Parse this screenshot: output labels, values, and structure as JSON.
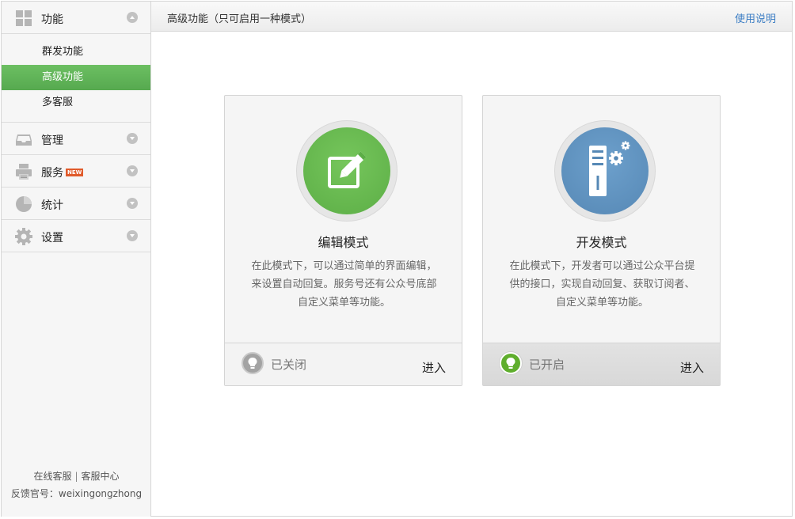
{
  "sidebar": {
    "groups": [
      {
        "label": "功能",
        "icon": "grid-icon",
        "arrow": "up"
      },
      {
        "label": "管理",
        "icon": "inbox-icon",
        "arrow": "down"
      },
      {
        "label": "服务",
        "icon": "printer-icon",
        "arrow": "down",
        "badge": "NEW"
      },
      {
        "label": "统计",
        "icon": "pie-chart-icon",
        "arrow": "down"
      },
      {
        "label": "设置",
        "icon": "gear-icon",
        "arrow": "down"
      }
    ],
    "function_items": [
      {
        "label": "群发功能"
      },
      {
        "label": "高级功能"
      },
      {
        "label": "多客服"
      }
    ],
    "footer": {
      "online_service": "在线客服",
      "separator": "|",
      "service_center": "客服中心",
      "feedback": "反馈官号：weixingongzhong"
    }
  },
  "header": {
    "title": "高级功能（只可启用一种模式）",
    "help": "使用说明"
  },
  "cards": [
    {
      "title": "编辑模式",
      "desc_lines": [
        "在此模式下，可以通过简单的界面编辑，",
        "来设置自动回复。服务号还有公众号底部",
        "自定义菜单等功能。"
      ],
      "status": "已关闭",
      "enter": "进入",
      "icon": "edit-icon",
      "color": "#66b94f"
    },
    {
      "title": "开发模式",
      "desc_lines": [
        "在此模式下，开发者可以通过公众平台提",
        "供的接口，实现自动回复、获取订阅者、",
        "自定义菜单等功能。"
      ],
      "status": "已开启",
      "enter": "进入",
      "icon": "server-gear-icon",
      "color": "#5c90bd"
    }
  ]
}
